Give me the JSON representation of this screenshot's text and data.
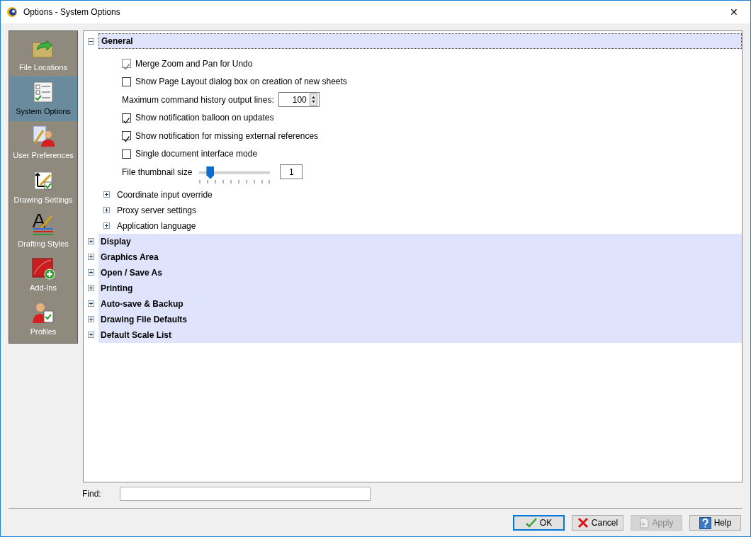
{
  "window": {
    "title": "Options - System Options",
    "close": "✕"
  },
  "sidebar": {
    "items": [
      {
        "label": "File Locations",
        "selected": false
      },
      {
        "label": "System Options",
        "selected": true
      },
      {
        "label": "User Preferences",
        "selected": false
      },
      {
        "label": "Drawing Settings",
        "selected": false
      },
      {
        "label": "Drafting Styles",
        "selected": false
      },
      {
        "label": "Add-Ins",
        "selected": false
      },
      {
        "label": "Profiles",
        "selected": false
      }
    ]
  },
  "tree": {
    "sections": [
      {
        "label": "General",
        "expanded": true,
        "selected": true,
        "options": [
          {
            "kind": "checkbox",
            "label": "Merge Zoom and Pan for Undo",
            "checked": true,
            "disabled": true
          },
          {
            "kind": "checkbox",
            "label": "Show Page Layout dialog box on creation of new sheets",
            "checked": false,
            "disabled": false
          },
          {
            "kind": "spin",
            "label": "Maximum command history output lines:",
            "value": "100"
          },
          {
            "kind": "checkbox",
            "label": "Show notification balloon on updates",
            "checked": true,
            "disabled": false
          },
          {
            "kind": "checkbox",
            "label": "Show notification for missing external references",
            "checked": true,
            "disabled": false
          },
          {
            "kind": "checkbox",
            "label": "Single document interface mode",
            "checked": false,
            "disabled": false
          },
          {
            "kind": "slider",
            "label": "File thumbnail size",
            "level": 0.15,
            "value": "1"
          }
        ],
        "children": [
          {
            "label": "Coordinate input override",
            "expanded": false
          },
          {
            "label": "Proxy server settings",
            "expanded": false
          },
          {
            "label": "Application language",
            "expanded": false
          }
        ]
      },
      {
        "label": "Display",
        "expanded": false,
        "selected": false
      },
      {
        "label": "Graphics Area",
        "expanded": false,
        "selected": false
      },
      {
        "label": "Open / Save As",
        "expanded": false,
        "selected": false
      },
      {
        "label": "Printing",
        "expanded": false,
        "selected": false
      },
      {
        "label": "Auto-save & Backup",
        "expanded": false,
        "selected": false
      },
      {
        "label": "Drawing File Defaults",
        "expanded": false,
        "selected": false
      },
      {
        "label": "Default Scale List",
        "expanded": false,
        "selected": false
      }
    ]
  },
  "find": {
    "label": "Find:"
  },
  "buttons": [
    {
      "label": "OK",
      "kind": "ok",
      "disabled": false,
      "default": true
    },
    {
      "label": "Cancel",
      "kind": "cancel",
      "disabled": false,
      "default": false
    },
    {
      "label": "Apply",
      "kind": "apply",
      "disabled": true,
      "default": false
    },
    {
      "label": "Help",
      "kind": "help",
      "disabled": false,
      "default": false
    }
  ]
}
